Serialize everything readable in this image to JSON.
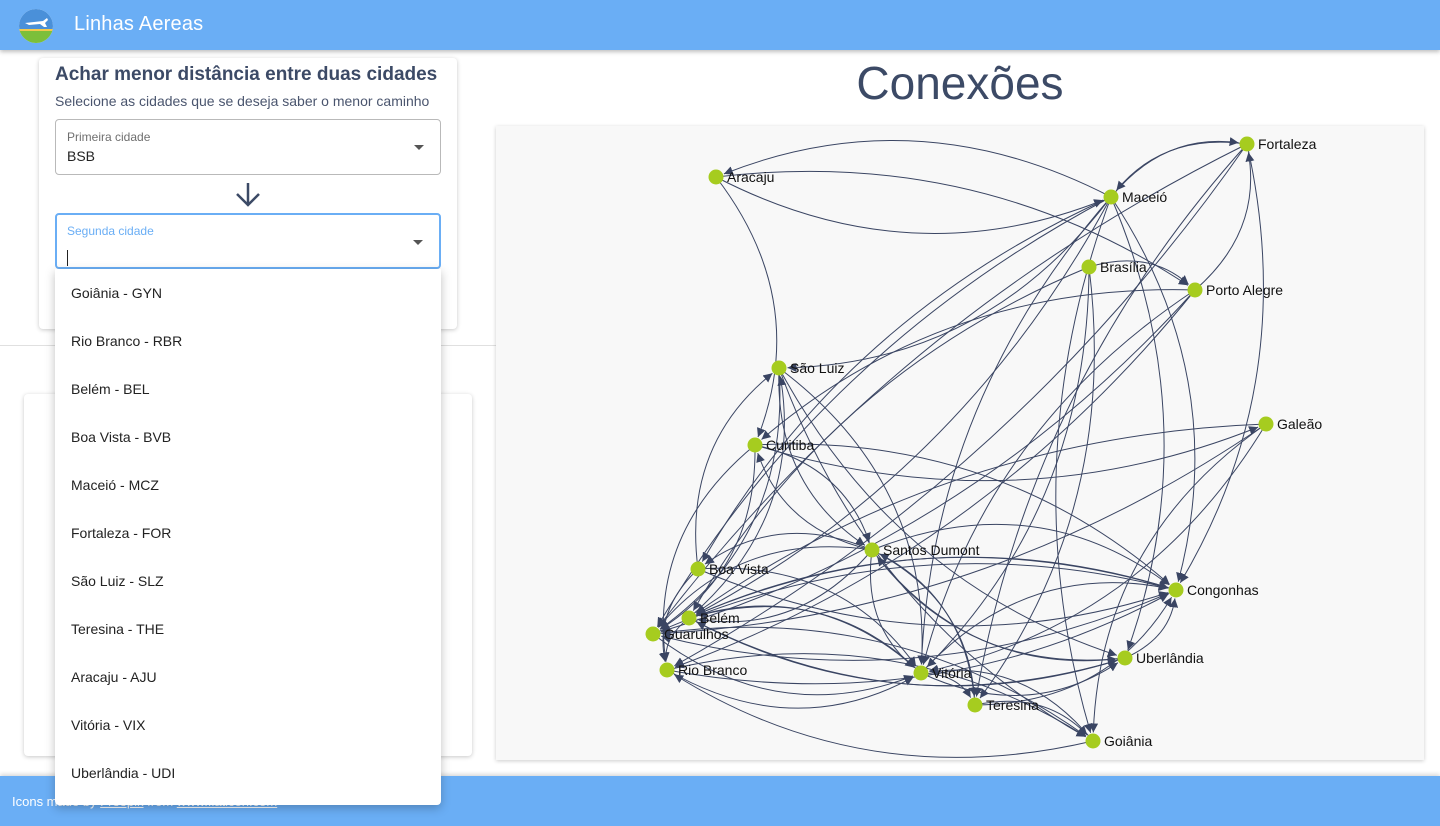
{
  "app": {
    "title": "Linhas Aereas"
  },
  "shortest_path": {
    "title": "Achar menor distância entre duas cidades",
    "subtitle": "Selecione as cidades que se deseja saber o menor caminho",
    "first_field": {
      "label": "Primeira cidade",
      "value": "BSB"
    },
    "second_field": {
      "label": "Segunda cidade",
      "value": ""
    }
  },
  "dropdown": {
    "options": [
      "Goiânia - GYN",
      "Rio Branco - RBR",
      "Belém - BEL",
      "Boa Vista - BVB",
      "Maceió - MCZ",
      "Fortaleza - FOR",
      "São Luiz - SLZ",
      "Teresina - THE",
      "Aracaju - AJU",
      "Vitória - VIX",
      "Uberlândia - UDI"
    ]
  },
  "graph": {
    "title": "Conexões",
    "node_color": "#a6cc1f",
    "edge_color": "#3a4563",
    "nodes": [
      {
        "id": "fortaleza",
        "label": "Fortaleza"
      },
      {
        "id": "aracaju",
        "label": "Aracaju"
      },
      {
        "id": "maceio",
        "label": "Maceió"
      },
      {
        "id": "brasilia",
        "label": "Brasília"
      },
      {
        "id": "portoalegre",
        "label": "Porto Alegre"
      },
      {
        "id": "saoluiz",
        "label": "São Luiz"
      },
      {
        "id": "galeao",
        "label": "Galeão"
      },
      {
        "id": "curitiba",
        "label": "Curitiba"
      },
      {
        "id": "santosdumont",
        "label": "Santos Dumont"
      },
      {
        "id": "boavista",
        "label": "Boa Vista"
      },
      {
        "id": "congonhas",
        "label": "Congonhas"
      },
      {
        "id": "belem",
        "label": "Belém"
      },
      {
        "id": "guarulhos",
        "label": "Guarulhos"
      },
      {
        "id": "uberlandia",
        "label": "Uberlândia"
      },
      {
        "id": "riobranco",
        "label": "Rio Branco"
      },
      {
        "id": "vitoria",
        "label": "Vitória"
      },
      {
        "id": "teresina",
        "label": "Teresina"
      },
      {
        "id": "goiania",
        "label": "Goiânia"
      }
    ],
    "edges": [
      [
        "aracaju",
        "maceio"
      ],
      [
        "aracaju",
        "curitiba"
      ],
      [
        "maceio",
        "aracaju"
      ],
      [
        "aracaju",
        "portoalegre"
      ],
      [
        "portoalegre",
        "fortaleza"
      ],
      [
        "maceio",
        "fortaleza"
      ],
      [
        "fortaleza",
        "maceio"
      ],
      [
        "fortaleza",
        "congonhas"
      ],
      [
        "maceio",
        "vitoria"
      ],
      [
        "maceio",
        "saoluiz"
      ],
      [
        "maceio",
        "guarulhos"
      ],
      [
        "maceio",
        "belem"
      ],
      [
        "maceio",
        "boavista"
      ],
      [
        "maceio",
        "uberlandia"
      ],
      [
        "maceio",
        "goiania"
      ],
      [
        "maceio",
        "congonhas"
      ],
      [
        "fortaleza",
        "guarulhos"
      ],
      [
        "fortaleza",
        "riobranco"
      ],
      [
        "fortaleza",
        "teresina"
      ],
      [
        "brasilia",
        "vitoria"
      ],
      [
        "brasilia",
        "belem"
      ],
      [
        "brasilia",
        "teresina"
      ],
      [
        "portoalegre",
        "curitiba"
      ],
      [
        "portoalegre",
        "guarulhos"
      ],
      [
        "portoalegre",
        "vitoria"
      ],
      [
        "portoalegre",
        "riobranco"
      ],
      [
        "saoluiz",
        "santosdumont"
      ],
      [
        "saoluiz",
        "vitoria"
      ],
      [
        "saoluiz",
        "uberlandia"
      ],
      [
        "saoluiz",
        "guarulhos"
      ],
      [
        "saoluiz",
        "goiania"
      ],
      [
        "boavista",
        "saoluiz"
      ],
      [
        "belem",
        "saoluiz"
      ],
      [
        "curitiba",
        "santosdumont"
      ],
      [
        "curitiba",
        "galeao"
      ],
      [
        "curitiba",
        "congonhas"
      ],
      [
        "curitiba",
        "riobranco"
      ],
      [
        "curitiba",
        "guarulhos"
      ],
      [
        "galeao",
        "belem"
      ],
      [
        "galeao",
        "vitoria"
      ],
      [
        "galeao",
        "goiania"
      ],
      [
        "galeao",
        "guarulhos"
      ],
      [
        "santosdumont",
        "boavista"
      ],
      [
        "santosdumont",
        "belem"
      ],
      [
        "santosdumont",
        "guarulhos"
      ],
      [
        "santosdumont",
        "congonhas"
      ],
      [
        "santosdumont",
        "vitoria"
      ],
      [
        "santosdumont",
        "teresina"
      ],
      [
        "santosdumont",
        "uberlandia"
      ],
      [
        "santosdumont",
        "curitiba"
      ],
      [
        "boavista",
        "congonhas"
      ],
      [
        "boavista",
        "vitoria"
      ],
      [
        "boavista",
        "riobranco"
      ],
      [
        "belem",
        "congonhas"
      ],
      [
        "belem",
        "uberlandia"
      ],
      [
        "belem",
        "vitoria"
      ],
      [
        "belem",
        "riobranco"
      ],
      [
        "guarulhos",
        "congonhas"
      ],
      [
        "guarulhos",
        "vitoria"
      ],
      [
        "guarulhos",
        "goiania"
      ],
      [
        "riobranco",
        "vitoria"
      ],
      [
        "riobranco",
        "goiania"
      ],
      [
        "riobranco",
        "congonhas"
      ],
      [
        "vitoria",
        "teresina"
      ],
      [
        "vitoria",
        "uberlandia"
      ],
      [
        "vitoria",
        "congonhas"
      ],
      [
        "teresina",
        "congonhas"
      ],
      [
        "teresina",
        "goiania"
      ],
      [
        "uberlandia",
        "congonhas"
      ],
      [
        "uberlandia",
        "santosdumont"
      ],
      [
        "goiania",
        "vitoria"
      ],
      [
        "goiania",
        "riobranco"
      ],
      [
        "congonhas",
        "belem"
      ],
      [
        "congonhas",
        "guarulhos"
      ],
      [
        "teresina",
        "santosdumont"
      ],
      [
        "uberlandia",
        "belem"
      ],
      [
        "vitoria",
        "belem"
      ],
      [
        "brasilia",
        "portoalegre"
      ]
    ]
  },
  "footer": {
    "text_prefix": "Icons made by",
    "link_1": "Freepik",
    "text_mid": "from",
    "link_2": "www.flaticon.com"
  }
}
